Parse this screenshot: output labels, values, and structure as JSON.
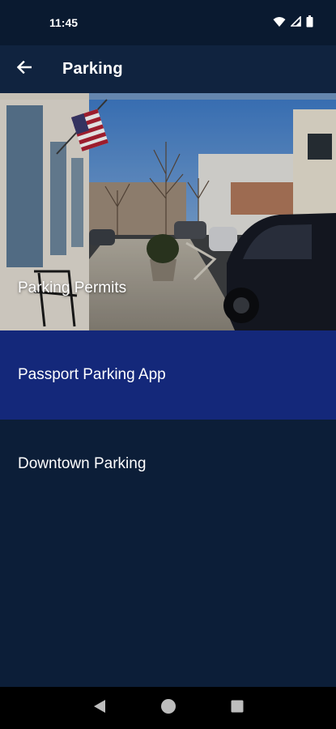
{
  "status_bar": {
    "time": "11:45"
  },
  "app_bar": {
    "title": "Parking"
  },
  "menu": {
    "items": [
      {
        "label": "Parking Permits"
      },
      {
        "label": "Passport Parking App"
      },
      {
        "label": "Downtown Parking"
      }
    ]
  },
  "colors": {
    "background": "#0c1e38",
    "app_bar": "#10233f",
    "highlight": "#14287a"
  },
  "icons": {
    "back": "arrow-left-icon",
    "wifi": "wifi-icon",
    "signal": "signal-icon",
    "battery": "battery-icon",
    "nav_back": "triangle-back-icon",
    "nav_home": "circle-home-icon",
    "nav_recents": "square-recents-icon"
  }
}
